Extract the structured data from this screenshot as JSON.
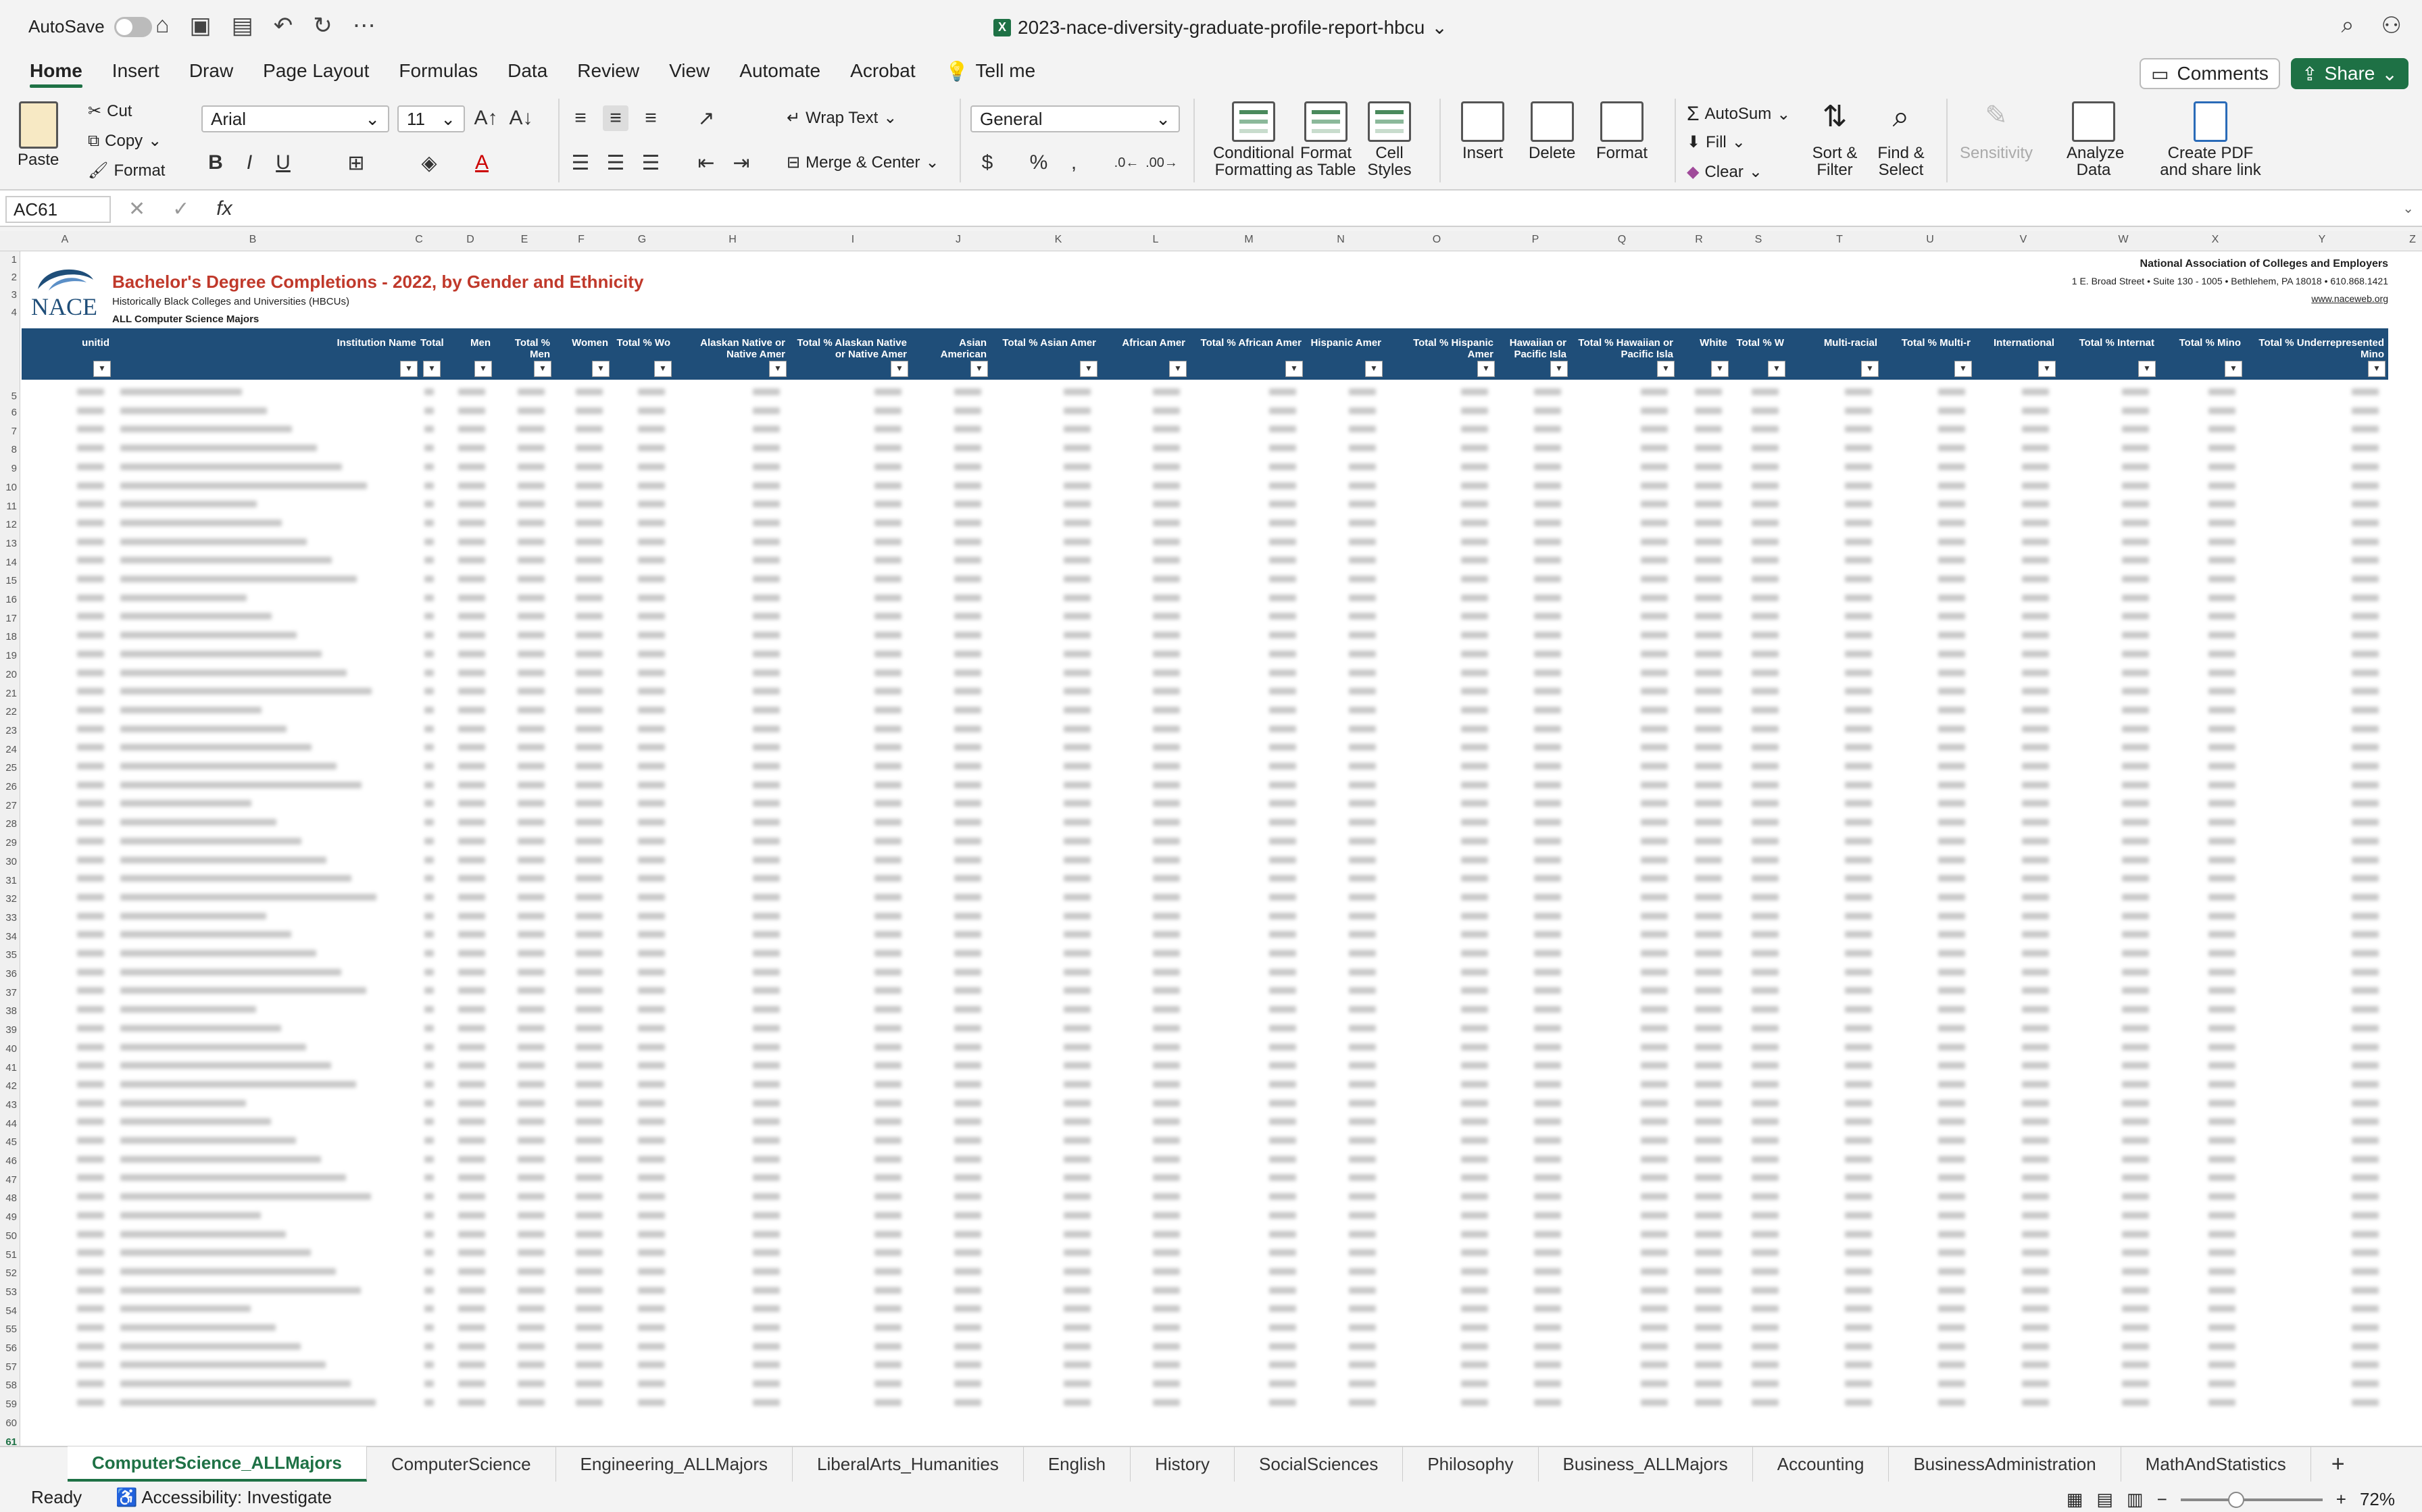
{
  "app": {
    "autosave_label": "AutoSave",
    "doc_title": "2023-nace-diversity-graduate-profile-report-hbcu",
    "tabs": [
      "Home",
      "Insert",
      "Draw",
      "Page Layout",
      "Formulas",
      "Data",
      "Review",
      "View",
      "Automate",
      "Acrobat"
    ],
    "tell_me": "Tell me",
    "comments": "Comments",
    "share": "Share"
  },
  "ribbon": {
    "paste": "Paste",
    "cut": "Cut",
    "copy": "Copy",
    "format": "Format",
    "font_name": "Arial",
    "font_size": "11",
    "wrap_text": "Wrap Text",
    "merge_center": "Merge & Center",
    "number_format": "General",
    "conditional_formatting": "Conditional Formatting",
    "format_as_table": "Format as Table",
    "cell_styles": "Cell Styles",
    "insert": "Insert",
    "delete": "Delete",
    "format_cells": "Format",
    "autosum": "AutoSum",
    "fill": "Fill",
    "clear": "Clear",
    "sort_filter": "Sort & Filter",
    "find_select": "Find & Select",
    "sensitivity": "Sensitivity",
    "analyze_data": "Analyze Data",
    "create_pdf": "Create PDF and share link"
  },
  "formula_bar": {
    "name_box": "AC61",
    "formula": ""
  },
  "sheet": {
    "columns": [
      "A",
      "B",
      "C",
      "D",
      "E",
      "F",
      "G",
      "H",
      "I",
      "J",
      "K",
      "L",
      "M",
      "N",
      "O",
      "P",
      "Q",
      "R",
      "S",
      "T",
      "U",
      "V",
      "W",
      "X",
      "Y",
      "Z"
    ],
    "title": "Bachelor's Degree Completions - 2022, by Gender and Ethnicity",
    "subtitle": "Historically Black Colleges and Universities (HBCUs)",
    "subtitle2": "ALL Computer Science Majors",
    "logo_text": "NACE",
    "org": "National Association of Colleges and Employers",
    "address": "1 E. Broad Street • Suite 130 - 1005 • Bethlehem, PA 18018 • 610.868.1421",
    "website": "www.naceweb.org",
    "headers": [
      "unitid",
      "Institution Name",
      "Total",
      "Men",
      "Total % Men",
      "Women",
      "Total % Women",
      "Alaskan Native or Native American",
      "Total % Alaskan Native or Native American",
      "Asian American",
      "Total % Asian American",
      "African American",
      "Total % African American",
      "Hispanic American",
      "Total % Hispanic American",
      "Hawaiian or Pacific Islander",
      "Total % Hawaiian or Pacific Islander",
      "White",
      "Total % White",
      "Multi-racial",
      "Total % Multi-racial",
      "International",
      "Total % International",
      "Total % Minority",
      "Total % Underrepresented Minority"
    ],
    "header_display": [
      "unitid",
      "Institution Name",
      "Total",
      "Men",
      "Total % Men",
      "Women",
      "Total % Wo",
      "Alaskan Native or Native Amer",
      "Total % Alaskan Native or Native Amer",
      "Asian American",
      "Total % Asian Amer",
      "African Amer",
      "Total % African Amer",
      "Hispanic Amer",
      "Total % Hispanic Amer",
      "Hawaiian or Pacific Isla",
      "Total % Hawaiian or Pacific Isla",
      "White",
      "Total % W",
      "Multi-racial",
      "Total % Multi-r",
      "International",
      "Total % Internat",
      "Total % Mino",
      "Total % Underrepresented Mino"
    ]
  },
  "sheet_tabs": [
    "ComputerScience_ALLMajors",
    "ComputerScience",
    "Engineering_ALLMajors",
    "LiberalArts_Humanities",
    "English",
    "History",
    "SocialSciences",
    "Philosophy",
    "Business_ALLMajors",
    "Accounting",
    "BusinessAdministration",
    "MathAndStatistics"
  ],
  "status": {
    "ready": "Ready",
    "accessibility": "Accessibility: Investigate",
    "zoom": "72%"
  },
  "colors": {
    "accent": "#1e7145",
    "header_band": "#1f4e79",
    "title_red": "#c0392b"
  }
}
